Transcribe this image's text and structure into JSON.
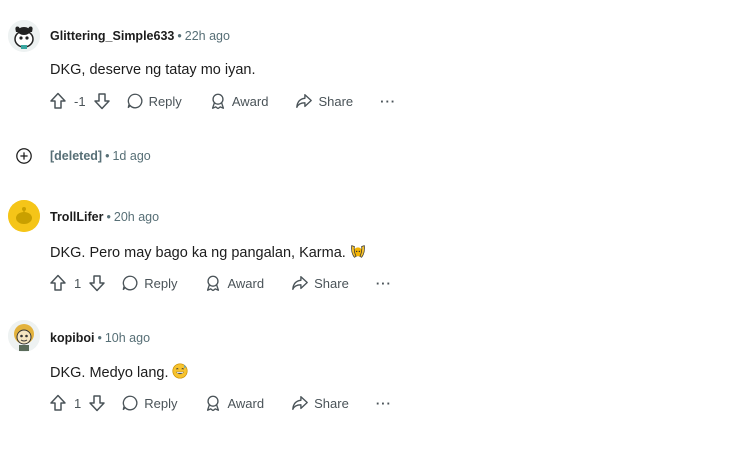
{
  "comments": [
    {
      "author": "Glittering_Simple633",
      "time": "22h ago",
      "text": "DKG, deserve ng tatay mo iyan.",
      "votes": "-1",
      "reply": "Reply",
      "award": "Award",
      "share": "Share",
      "more": "···",
      "avatar_icon": "snoo-avatar-dog-icon"
    },
    {
      "author": "TrollLifer",
      "time": "20h ago",
      "text": "DKG. Pero may bago ka ng pangalan, Karma.",
      "emoji": "raising-hands-emoji",
      "votes": "1",
      "reply": "Reply",
      "award": "Award",
      "share": "Share",
      "more": "···",
      "avatar_icon": "snoo-avatar-yellow-icon"
    },
    {
      "author": "kopiboi",
      "time": "10h ago",
      "text": "DKG. Medyo lang.",
      "emoji": "grinning-sweat-emoji",
      "votes": "1",
      "reply": "Reply",
      "award": "Award",
      "share": "Share",
      "more": "···",
      "avatar_icon": "snoo-avatar-lion-icon"
    }
  ],
  "deleted": {
    "author": "[deleted]",
    "time": "1d ago"
  },
  "colors": {
    "meta": "#576f76",
    "action": "#4a5358",
    "avatar_yellow": "#f5c518"
  }
}
